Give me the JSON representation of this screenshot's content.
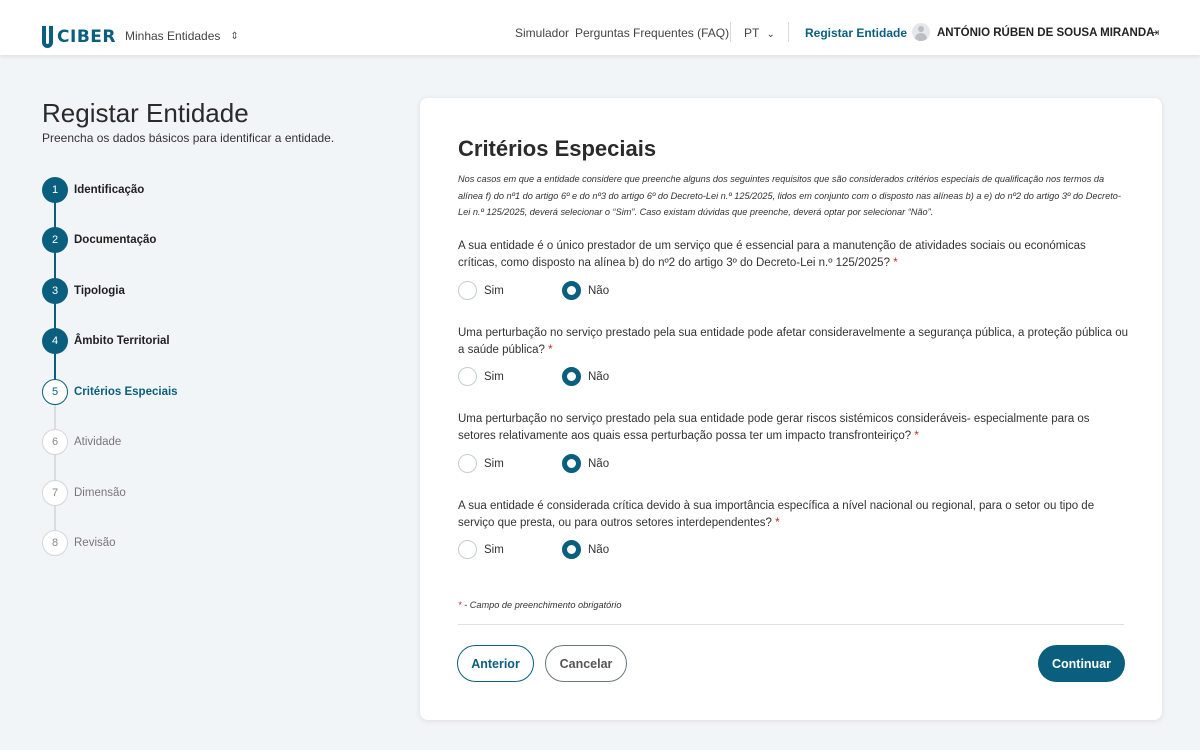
{
  "header": {
    "logo_text": "CIBER",
    "entity_switch_label": "Minhas Entidades",
    "nav": {
      "simulator": "Simulador",
      "faq": "Perguntas Frequentes (FAQ)",
      "language": "PT",
      "register_entity": "Registar Entidade"
    },
    "user_name": "ANTÓNIO RÚBEN DE SOUSA MIRANDA"
  },
  "page": {
    "title": "Registar Entidade",
    "subtitle": "Preencha os dados básicos para identificar a entidade."
  },
  "steps": [
    {
      "number": "1",
      "label": "Identificação",
      "state": "done"
    },
    {
      "number": "2",
      "label": "Documentação",
      "state": "done"
    },
    {
      "number": "3",
      "label": "Tipologia",
      "state": "done"
    },
    {
      "number": "4",
      "label": "Âmbito Territorial",
      "state": "done"
    },
    {
      "number": "5",
      "label": "Critérios Especiais",
      "state": "current"
    },
    {
      "number": "6",
      "label": "Atividade",
      "state": "todo"
    },
    {
      "number": "7",
      "label": "Dimensão",
      "state": "todo"
    },
    {
      "number": "8",
      "label": "Revisão",
      "state": "todo"
    }
  ],
  "form": {
    "title": "Critérios Especiais",
    "intro": "Nos casos em que a entidade considere que preenche alguns dos seguintes requisitos que são considerados critérios especiais de qualificação nos termos da alínea f) do nº1 do artigo 6º e do nº3 do artigo 6º do Decreto-Lei n.º 125/2025, lidos em conjunto com o disposto nas alíneas b) a e) do nº2 do artigo 3º do Decreto-Lei n.º 125/2025, deverá selecionar o “Sim”. Caso existam dúvidas que preenche, deverá optar por selecionar “Não”.",
    "required_mark": "*",
    "yes_label": "Sim",
    "no_label": "Não",
    "questions": [
      {
        "text": "A sua entidade é o único prestador de um serviço que é essencial para a manutenção de atividades sociais ou económicas críticas, como disposto na alínea b) do nº2 do artigo 3º do Decreto-Lei n.º 125/2025?",
        "selected": "Não"
      },
      {
        "text": "Uma perturbação no serviço prestado pela sua entidade pode afetar consideravelmente a segurança pública, a proteção pública ou a saúde pública?",
        "selected": "Não"
      },
      {
        "text": "Uma perturbação no serviço prestado pela sua entidade pode gerar riscos sistémicos consideráveis- especialmente para os setores relativamente aos quais essa perturbação possa ter um impacto transfronteiriço?",
        "selected": "Não"
      },
      {
        "text": "A sua entidade é considerada crítica devido à sua importância específica a nível nacional ou regional, para o setor ou tipo de serviço que presta, ou para outros setores interdependentes?",
        "selected": "Não"
      }
    ],
    "footnote": "- Campo de preenchimento obrigatório",
    "buttons": {
      "back": "Anterior",
      "cancel": "Cancelar",
      "continue": "Continuar"
    }
  },
  "colors": {
    "primary": "#0b5f7e",
    "background": "#f2f5f8",
    "required": "#c62828"
  }
}
